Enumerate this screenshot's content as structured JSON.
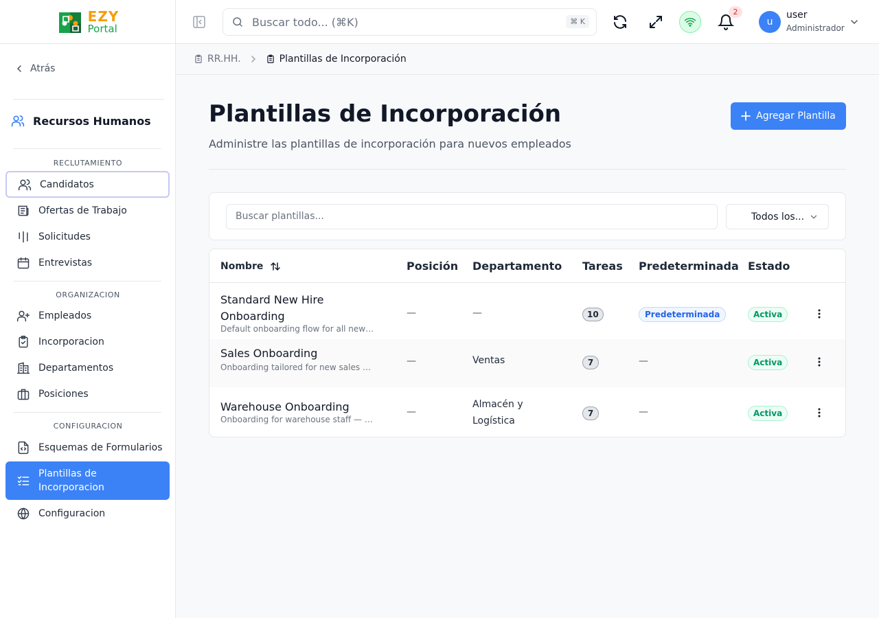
{
  "brand": {
    "line1": "EZY",
    "line2": "Portal"
  },
  "sidebar": {
    "back_label": "Atrás",
    "module_title": "Recursos Humanos",
    "sections": [
      {
        "label": "RECLUTAMIENTO",
        "items": [
          {
            "label": "Candidatos",
            "icon": "users-icon"
          },
          {
            "label": "Ofertas de Trabajo",
            "icon": "newspaper-icon"
          },
          {
            "label": "Solicitudes",
            "icon": "columns-icon"
          },
          {
            "label": "Entrevistas",
            "icon": "calendar-icon"
          }
        ]
      },
      {
        "label": "ORGANIZACION",
        "items": [
          {
            "label": "Empleados",
            "icon": "user-plus-icon"
          },
          {
            "label": "Incorporacion",
            "icon": "clipboard-check-icon"
          },
          {
            "label": "Departamentos",
            "icon": "building-icon"
          },
          {
            "label": "Posiciones",
            "icon": "briefcase-icon"
          }
        ]
      },
      {
        "label": "CONFIGURACION",
        "items": [
          {
            "label": "Esquemas de Formularios",
            "icon": "file-code-icon"
          },
          {
            "label": "Plantillas de Incorporacion",
            "icon": "list-checks-icon",
            "active": true
          },
          {
            "label": "Configuracion",
            "icon": "globe-icon"
          }
        ]
      }
    ]
  },
  "header": {
    "search_placeholder": "Buscar todo... (⌘K)",
    "search_shortcut": "⌘ K",
    "notification_count": "2",
    "user": {
      "initial": "u",
      "name": "user",
      "role": "Administrador"
    }
  },
  "breadcrumb": {
    "parent": "RR.HH.",
    "current": "Plantillas de Incorporación"
  },
  "page": {
    "title": "Plantillas de Incorporación",
    "subtitle": "Administre las plantillas de incorporación para nuevos empleados",
    "add_button": "Agregar Plantilla"
  },
  "filters": {
    "search_placeholder": "Buscar plantillas...",
    "select_value": "Todos los..."
  },
  "table": {
    "columns": [
      "Nombre",
      "Posición",
      "Departamento",
      "Tareas",
      "Predeterminada",
      "Estado"
    ],
    "rows": [
      {
        "name": "Standard New Hire Onboarding",
        "description": "Default onboarding flow for all new h...",
        "position": "—",
        "department": "—",
        "tasks": "10",
        "default": "Predeterminada",
        "status": "Activa"
      },
      {
        "name": "Sales Onboarding",
        "description": "Onboarding tailored for new sales hir...",
        "position": "—",
        "department": "Ventas",
        "tasks": "7",
        "default": "—",
        "status": "Activa"
      },
      {
        "name": "Warehouse Onboarding",
        "description": "Onboarding for warehouse staff — s...",
        "position": "—",
        "department": "Almacén y Logística",
        "tasks": "7",
        "default": "—",
        "status": "Activa"
      }
    ]
  },
  "colors": {
    "accent": "#3b82f6",
    "brand_orange": "#f59e0b",
    "brand_green": "#16a34a",
    "status_green": "#059669"
  }
}
